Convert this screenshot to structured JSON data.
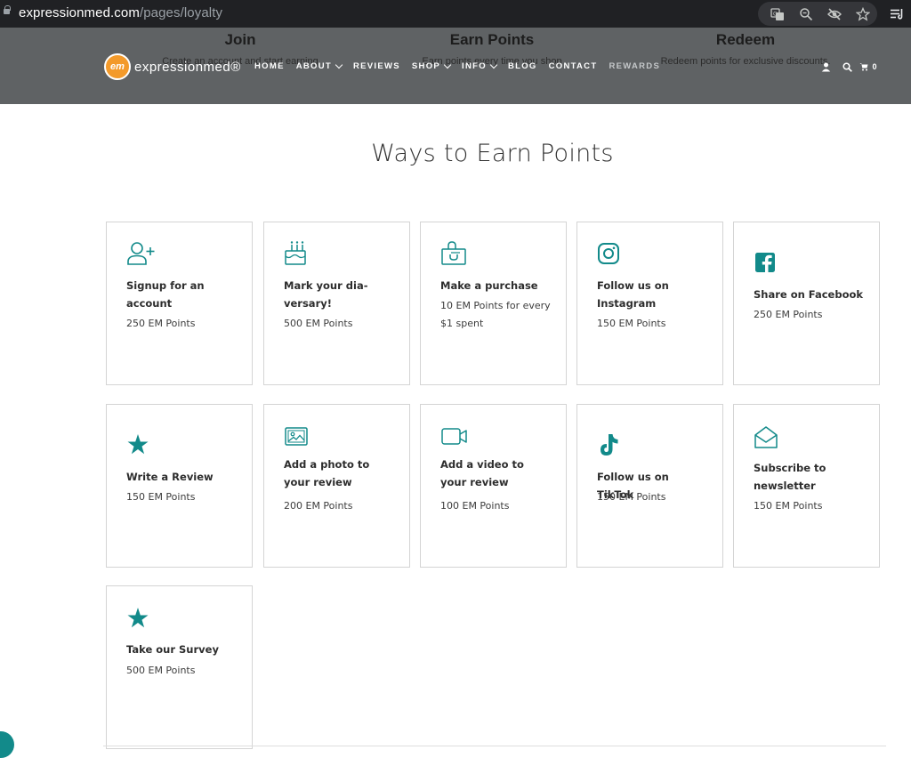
{
  "browser": {
    "domain": "expressionmed.com",
    "path": "/pages/loyalty",
    "icons": [
      "translate-icon",
      "zoom-icon",
      "eye-off-icon",
      "star-icon",
      "reading-list-icon"
    ]
  },
  "steps": {
    "join": {
      "title": "Join",
      "desc": "Create an account and start earning"
    },
    "earn": {
      "title": "Earn Points",
      "desc": "Earn points every time you shop"
    },
    "redeem": {
      "title": "Redeem",
      "desc": "Redeem points for exclusive discounts."
    }
  },
  "header": {
    "logo_mark": "em",
    "logo_text": "expressionmed®",
    "nav": {
      "home": "HOME",
      "about": "ABOUT",
      "reviews": "REVIEWS",
      "shop": "SHOP",
      "info": "INFO",
      "blog": "BLOG",
      "contact": "CONTACT",
      "rewards": "REWARDS"
    },
    "cart_count": "0"
  },
  "main": {
    "title": "Ways to Earn Points",
    "accent_color": "#128a8a",
    "cards": [
      {
        "icon": "add-user-icon",
        "title": "Signup for an account",
        "points": "250 EM Points"
      },
      {
        "icon": "cake-icon",
        "title": "Mark your dia-versary!",
        "points": "500 EM Points"
      },
      {
        "icon": "shopping-bag-icon",
        "title": "Make a purchase",
        "points": "10 EM Points for every $1 spent"
      },
      {
        "icon": "instagram-icon",
        "title": "Follow us on Instagram",
        "points": "150 EM Points"
      },
      {
        "icon": "facebook-icon",
        "title": "Share on Facebook",
        "points": "250 EM Points"
      },
      {
        "icon": "star-icon",
        "title": "Write a Review",
        "points": "150 EM Points"
      },
      {
        "icon": "photo-icon",
        "title": "Add a photo to your review",
        "points": "200 EM Points"
      },
      {
        "icon": "video-icon",
        "title": "Add a video to your review",
        "points": "100 EM Points"
      },
      {
        "icon": "tiktok-icon",
        "title": "Follow us on TikTok",
        "points": "150 EM Points"
      },
      {
        "icon": "envelope-icon",
        "title": "Subscribe to newsletter",
        "points": "150 EM Points"
      },
      {
        "icon": "star-icon",
        "title": "Take our Survey",
        "points": "500 EM Points"
      }
    ]
  }
}
